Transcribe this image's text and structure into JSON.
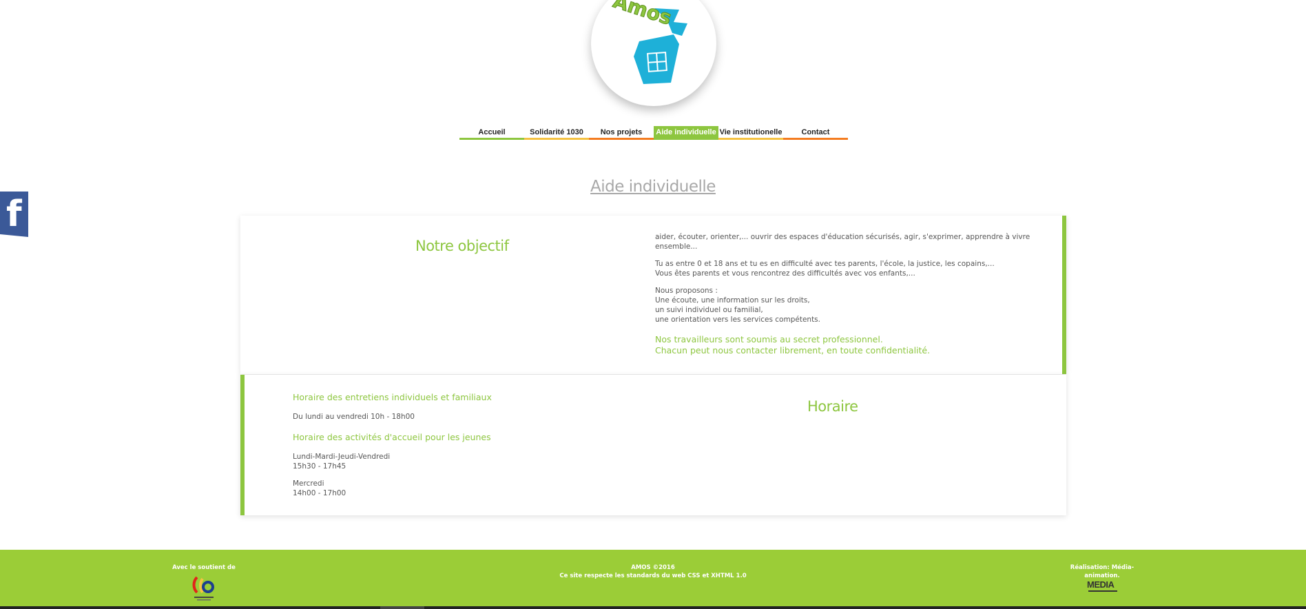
{
  "logo": {
    "brand_text": "Amos"
  },
  "nav": {
    "items": [
      {
        "label": "Accueil",
        "color": "#8dc63f",
        "active": false
      },
      {
        "label": "Solidarité 1030",
        "color": "#f5c242",
        "active": false
      },
      {
        "label": "Nos projets",
        "color": "#f47c20",
        "active": false
      },
      {
        "label": "Aide individuelle",
        "color": "#8dc63f",
        "active": true
      },
      {
        "label": "Vie institutionelle",
        "color": "#f5c242",
        "active": false
      },
      {
        "label": "Contact",
        "color": "#f47c20",
        "active": false
      }
    ]
  },
  "page": {
    "title": "Aide individuelle"
  },
  "social": {
    "facebook_icon": "facebook-icon",
    "letter": "f"
  },
  "objectif": {
    "title": "Notre objectif",
    "paragraphs": [
      [
        "aider, écouter, orienter,... ouvrir des espaces d'éducation sécurisés, agir, s'exprimer, apprendre à vivre",
        "ensemble..."
      ],
      [
        "Tu as entre 0 et 18 ans et tu es en difficulté avec tes parents, l'école, la justice, les copains,...",
        "Vous êtes parents et vous rencontrez des difficultés avec vos enfants,..."
      ],
      [
        "Nous proposons :",
        "Une écoute, une information sur les droits,",
        "un suivi individuel ou familial,",
        "une orientation vers les services compétents."
      ]
    ],
    "note": [
      "Nos travailleurs sont soumis au secret professionnel.",
      "Chacun peut nous contacter librement, en toute confidentialité."
    ]
  },
  "horaire": {
    "title": "Horaire",
    "sub1": "Horaire des entretiens individuels et familiaux",
    "line1": "Du lundi au vendredi 10h - 18h00",
    "sub2": "Horaire des activités d'accueil pour les jeunes",
    "block1": [
      "Lundi-Mardi-Jeudi-Vendredi",
      "15h30 - 17h45"
    ],
    "block2": [
      "Mercredi",
      "14h00 - 17h00"
    ]
  },
  "footer": {
    "left_label": "Avec le soutient de",
    "center_line1": "AMOS ©2016",
    "center_line2": "Ce site respecte les standards du web CSS et XHTML 1.0",
    "right_label": "Réalisation: Média-animation.",
    "right_logo_text": "MEDIA",
    "colors": {
      "bg": "#9bcd37",
      "accent": "#8dc63f"
    }
  }
}
